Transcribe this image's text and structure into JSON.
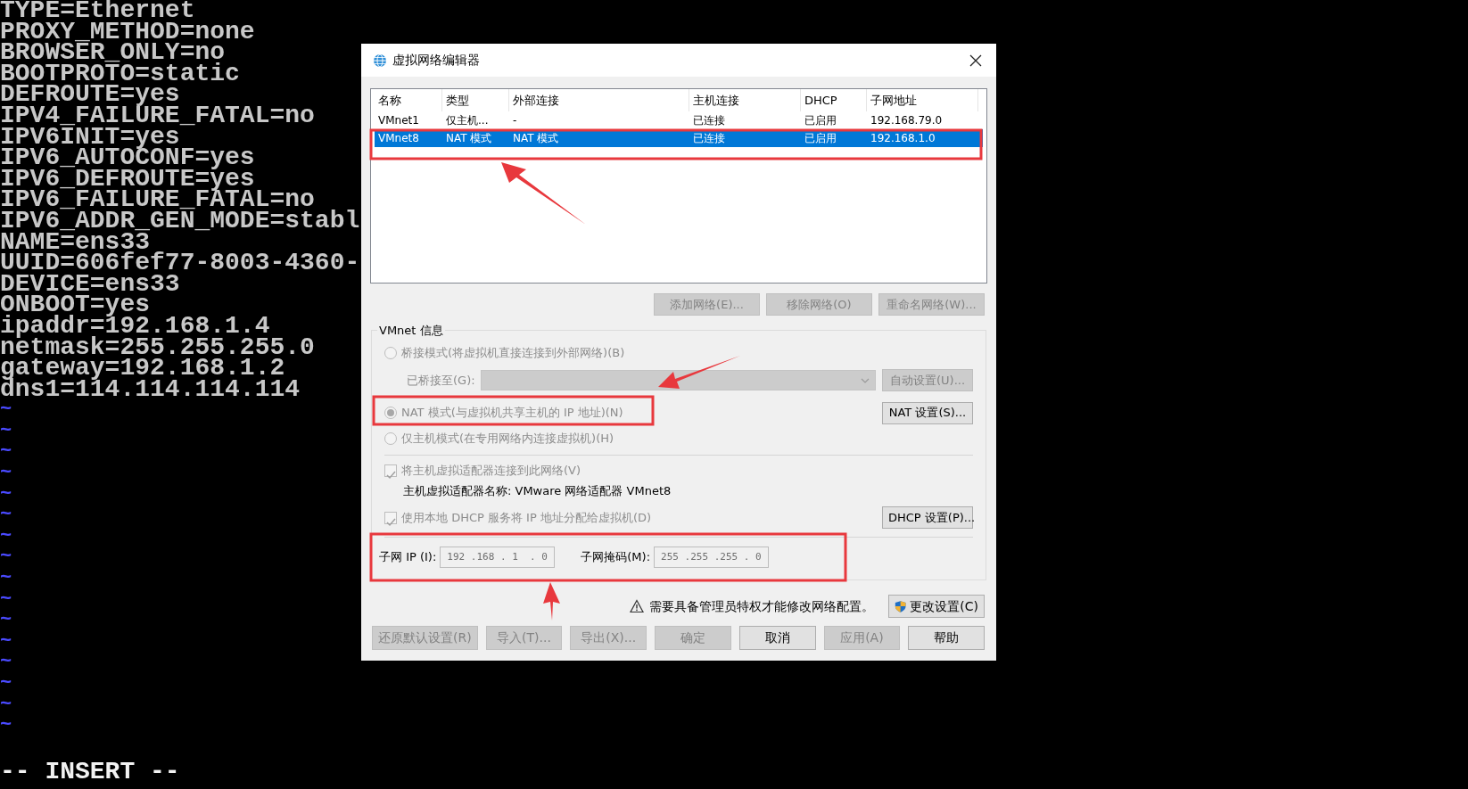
{
  "terminal": {
    "lines": [
      "TYPE=Ethernet",
      "PROXY_METHOD=none",
      "BROWSER_ONLY=no",
      "BOOTPROTO=static",
      "DEFROUTE=yes",
      "IPV4_FAILURE_FATAL=no",
      "IPV6INIT=yes",
      "IPV6_AUTOCONF=yes",
      "IPV6_DEFROUTE=yes",
      "IPV6_FAILURE_FATAL=no",
      "IPV6_ADDR_GEN_MODE=stabl",
      "NAME=ens33",
      "UUID=606fef77-8003-4360-",
      "DEVICE=ens33",
      "ONBOOT=yes",
      "ipaddr=192.168.1.4",
      "netmask=255.255.255.0",
      "gateway=192.168.1.2",
      "dns1=114.114.114.114"
    ],
    "empty_line_markers": [
      "~",
      "~",
      "~",
      "~",
      "~",
      "~",
      "~",
      "~",
      "~",
      "~",
      "~",
      "~",
      "~",
      "~",
      "~",
      "~"
    ],
    "mode_line": "-- INSERT --"
  },
  "dialog": {
    "title": "虚拟网络编辑器",
    "network_table": {
      "columns": [
        "名称",
        "类型",
        "外部连接",
        "主机连接",
        "DHCP",
        "子网地址"
      ],
      "rows": [
        {
          "cells": [
            "VMnet1",
            "仅主机...",
            "-",
            "已连接",
            "已启用",
            "192.168.79.0"
          ],
          "selected": false
        },
        {
          "cells": [
            "VMnet8",
            "NAT 模式",
            "NAT 模式",
            "已连接",
            "已启用",
            "192.168.1.0"
          ],
          "selected": true
        }
      ]
    },
    "network_buttons": [
      {
        "label": "添加网络(E)...",
        "disabled": true
      },
      {
        "label": "移除网络(O)",
        "disabled": true
      },
      {
        "label": "重命名网络(W)...",
        "disabled": true
      }
    ],
    "vmnet_info": {
      "title": "VMnet 信息",
      "modes": [
        {
          "label": "桥接模式(将虚拟机直接连接到外部网络)(B)",
          "selected": false,
          "disabled": true
        },
        {
          "label": "NAT 模式(与虚拟机共享主机的 IP 地址)(N)",
          "selected": true,
          "disabled": true
        },
        {
          "label": "仅主机模式(在专用网络内连接虚拟机)(H)",
          "selected": false,
          "disabled": true
        }
      ],
      "bridged_to": {
        "label": "已桥接至(G):",
        "disabled": true
      },
      "auto_button": {
        "label": "自动设置(U)...",
        "disabled": true
      },
      "nat_button": {
        "label": "NAT 设置(S)...",
        "disabled": false
      },
      "host_adapter": {
        "label": "将主机虚拟适配器连接到此网络(V)",
        "checked": true,
        "disabled": true
      },
      "adapter_name": "主机虚拟适配器名称: VMware 网络适配器 VMnet8",
      "dhcp": {
        "label": "使用本地 DHCP 服务将 IP 地址分配给虚拟机(D)",
        "checked": true,
        "disabled": true
      },
      "dhcp_button": {
        "label": "DHCP 设置(P)...",
        "disabled": false
      },
      "subnet_ip": {
        "label": "子网 IP (I):",
        "value": "192 .168 . 1  . 0"
      },
      "subnet_mask": {
        "label": "子网掩码(M):",
        "value": "255 .255 .255 . 0"
      }
    },
    "warning": "需要具备管理员特权才能修改网络配置。",
    "change_settings_button": {
      "label": "更改设置(C)",
      "disabled": false
    },
    "footer_buttons": [
      {
        "label": "还原默认设置(R)",
        "disabled": true
      },
      {
        "label": "导入(T)...",
        "disabled": true
      },
      {
        "label": "导出(X)...",
        "disabled": true
      },
      {
        "label": "确定",
        "disabled": true
      },
      {
        "label": "取消",
        "disabled": false
      },
      {
        "label": "应用(A)",
        "disabled": true
      },
      {
        "label": "帮助",
        "disabled": false
      }
    ]
  }
}
